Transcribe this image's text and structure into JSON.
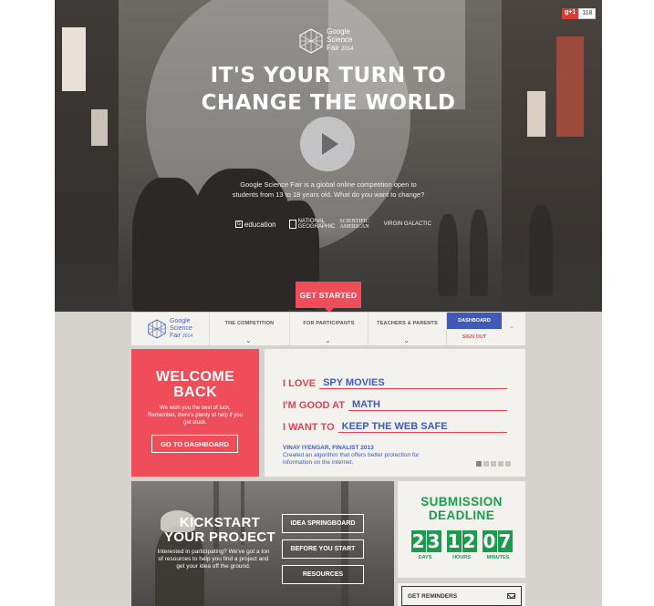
{
  "share": {
    "gplus_label": "g+1",
    "count": "118"
  },
  "hero": {
    "logo_line1": "Google",
    "logo_line2": "Science",
    "logo_line3": "Fair",
    "logo_year": "2014",
    "title_line1": "IT'S YOUR TURN TO",
    "title_line2": "CHANGE THE WORLD",
    "description": "Google Science Fair is a global online competition open to students from 13 to 18 years old. What do you want to change?",
    "partners": [
      "education",
      "NATIONAL GEOGRAPHIC",
      "SCIENTIFIC AMERICAN",
      "VIRGIN GALACTIC"
    ],
    "cta": "GET STARTED"
  },
  "nav": {
    "logo_line1": "Google",
    "logo_line2": "Science",
    "logo_line3": "Fair",
    "logo_year": "2014",
    "items": [
      "THE COMPETITION",
      "FOR PARTICIPANTS",
      "TEACHERS & PARENTS"
    ],
    "dashboard": "DASHBOARD",
    "sign_out": "SIGN OUT"
  },
  "welcome": {
    "title_line1": "WELCOME",
    "title_line2": "BACK",
    "message": "We wish you the best of luck. Remember, there's plenty of help if you get stuck.",
    "button": "GO TO DASHBOARD"
  },
  "madlib": {
    "lines": [
      {
        "label": "I LOVE",
        "value": "SPY MOVIES"
      },
      {
        "label": "I'M GOOD AT",
        "value": "MATH"
      },
      {
        "label": "I WANT TO",
        "value": "KEEP THE WEB SAFE"
      }
    ],
    "finalist_name": "VINAY IYENGAR, FINALIST 2013",
    "finalist_desc": "Created an algorithm that offers better protection for information on the internet.",
    "active_dot": 0,
    "dot_count": 5
  },
  "kickstart": {
    "title_line1": "KICKSTART",
    "title_line2": "YOUR PROJECT",
    "message": "Interested in participating? We've got a ton of resources to help you find a project and get your idea off the ground.",
    "buttons": [
      "IDEA SPRINGBOARD",
      "BEFORE YOU START",
      "RESOURCES"
    ]
  },
  "deadline": {
    "title_line1": "SUBMISSION",
    "title_line2": "DEADLINE",
    "days": [
      "2",
      "3"
    ],
    "hours": [
      "1",
      "2"
    ],
    "minutes": [
      "0",
      "7"
    ],
    "days_label": "DAYS",
    "hours_label": "HOURS",
    "minutes_label": "MINUTES",
    "reminders": "GET REMINDERS"
  },
  "colors": {
    "red": "#f04d5b",
    "blue": "#3f5bb7",
    "green": "#1a9c4c",
    "cream": "#f4f2ee"
  }
}
